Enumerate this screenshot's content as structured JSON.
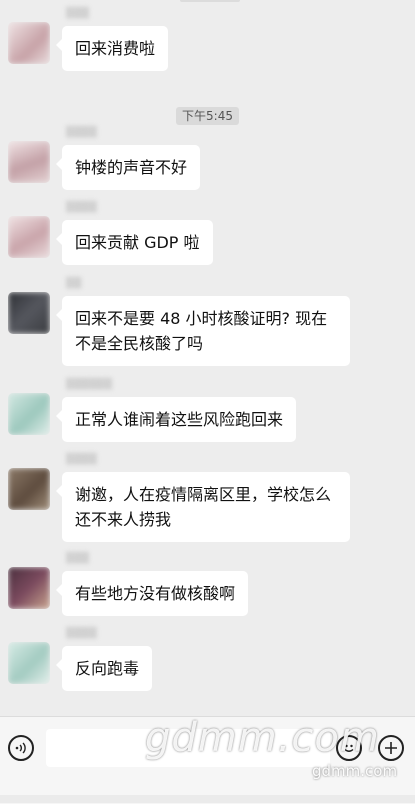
{
  "timestamp": "下午5:45",
  "messages": [
    {
      "text": "回来消费啦",
      "avatar_color": "#d8b9bd"
    },
    {
      "text": "钟楼的声音不好",
      "avatar_color": "#c9a7ad"
    },
    {
      "text": "回来贡献 GDP 啦",
      "avatar_color": "#d5b4b8"
    },
    {
      "text": "回来不是要 48 小时核酸证明? 现在不是全民核酸了吗",
      "avatar_color": "#3b3d42"
    },
    {
      "text": "正常人谁闹着这些风险跑回来",
      "avatar_color": "#b9d6cf"
    },
    {
      "text": "谢邀，人在疫情隔离区里，学校怎么还不来人捞我",
      "avatar_color": "#7a6a5c"
    },
    {
      "text": "有些地方没有做核酸啊",
      "avatar_color": "#5a3a4a"
    },
    {
      "text": "反向跑毒",
      "avatar_color": "#bcd9d1"
    }
  ],
  "input_bar": {
    "voice_icon": "voice-icon",
    "emoji_icon": "emoji-icon",
    "plus_icon": "plus-icon"
  },
  "watermark": {
    "main": "gdmm.com",
    "small": "gdmm.com"
  }
}
